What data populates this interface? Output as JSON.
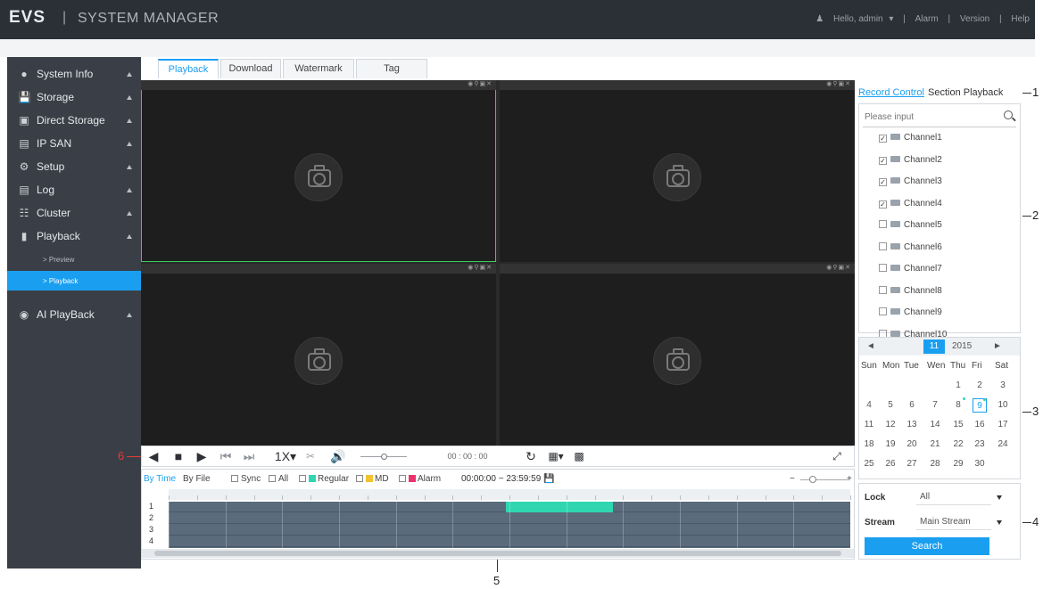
{
  "header": {
    "logo": "EVS",
    "separator": "|",
    "app_title": "SYSTEM MANAGER",
    "user": "Hello, admin",
    "links": [
      "Alarm",
      "Version",
      "Help"
    ]
  },
  "sidebar": {
    "items": [
      {
        "label": "System Info",
        "icon": "info-icon"
      },
      {
        "label": "Storage",
        "icon": "storage-icon"
      },
      {
        "label": "Direct Storage",
        "icon": "direct-storage-icon"
      },
      {
        "label": "IP SAN",
        "icon": "ip-san-icon"
      },
      {
        "label": "Setup",
        "icon": "gear-icon"
      },
      {
        "label": "Log",
        "icon": "log-icon"
      },
      {
        "label": "Cluster",
        "icon": "cluster-icon"
      },
      {
        "label": "Playback",
        "icon": "playback-icon"
      }
    ],
    "sub_items": [
      {
        "label": "> Preview",
        "active": false
      },
      {
        "label": "> Playback",
        "active": true
      }
    ],
    "extra": {
      "label": "AI PlayBack",
      "icon": "ai-playback-icon"
    }
  },
  "tabs": [
    "Playback",
    "Download",
    "Watermark",
    "Tag"
  ],
  "active_tab": "Playback",
  "controls": {
    "speed": "1X",
    "time": "00 : 00 : 00"
  },
  "timeline": {
    "by_time": "By Time",
    "by_file": "By File",
    "sync": "Sync",
    "all": "All",
    "regular": "Regular",
    "md": "MD",
    "alarm": "Alarm",
    "start": "00:00:00",
    "range_sep": "~",
    "end": "23:59:59",
    "track_labels": [
      "1",
      "2",
      "3",
      "4"
    ],
    "colors": {
      "regular": "#2fd6b0",
      "md": "#f2c230",
      "alarm": "#e8336b"
    }
  },
  "right_panel": {
    "tabs": [
      "Record Control",
      "Section Playback"
    ],
    "search_placeholder": "Please input",
    "channels": [
      {
        "label": "Channel1",
        "checked": true
      },
      {
        "label": "Channel2",
        "checked": true
      },
      {
        "label": "Channel3",
        "checked": true
      },
      {
        "label": "Channel4",
        "checked": true
      },
      {
        "label": "Channel5",
        "checked": false
      },
      {
        "label": "Channel6",
        "checked": false
      },
      {
        "label": "Channel7",
        "checked": false
      },
      {
        "label": "Channel8",
        "checked": false
      },
      {
        "label": "Channel9",
        "checked": false
      },
      {
        "label": "Channel10",
        "checked": false
      }
    ]
  },
  "calendar": {
    "prev": "◄",
    "next": "►",
    "month": "11",
    "year": "2015",
    "weekdays": [
      "Sun",
      "Mon",
      "Tue",
      "Wen",
      "Thu",
      "Fri",
      "Sat"
    ],
    "weeks": [
      [
        "",
        "",
        "",
        "",
        "1",
        "2",
        "3"
      ],
      [
        "4",
        "5",
        "6",
        "7",
        "8",
        "9",
        "10"
      ],
      [
        "11",
        "12",
        "13",
        "14",
        "15",
        "16",
        "17"
      ],
      [
        "18",
        "19",
        "20",
        "21",
        "22",
        "23",
        "24"
      ],
      [
        "25",
        "26",
        "27",
        "28",
        "29",
        "30",
        ""
      ]
    ],
    "selected": "9",
    "record_days": [
      "8",
      "9"
    ]
  },
  "filters": {
    "lock_label": "Lock",
    "lock_value": "All",
    "stream_label": "Stream",
    "stream_value": "Main Stream",
    "search_button": "Search"
  },
  "callouts": [
    "1",
    "2",
    "3",
    "4",
    "5",
    "6"
  ]
}
